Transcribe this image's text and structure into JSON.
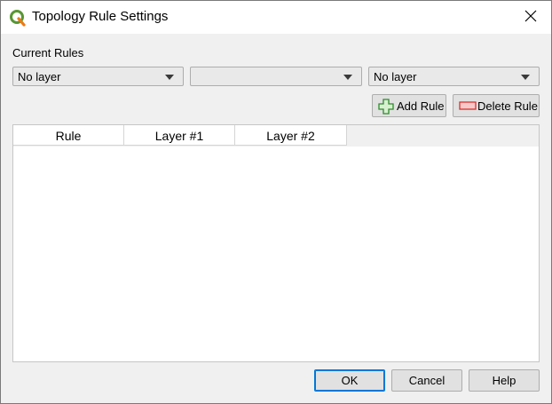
{
  "window": {
    "title": "Topology Rule Settings",
    "app_icon": "qgis-icon",
    "close_icon": "close-icon"
  },
  "current_rules": {
    "label": "Current Rules",
    "layer1_combo": {
      "value": "No layer"
    },
    "rule_combo": {
      "value": ""
    },
    "layer2_combo": {
      "value": "No layer"
    }
  },
  "actions": {
    "add_rule": {
      "label": "Add Rule",
      "icon": "plus-icon",
      "color": "#2e8b2e"
    },
    "delete_rule": {
      "label": "Delete Rule",
      "icon": "minus-icon",
      "color": "#d9302c"
    }
  },
  "rules_table": {
    "columns": [
      "Rule",
      "Layer #1",
      "Layer #2"
    ],
    "rows": []
  },
  "footer": {
    "ok": "OK",
    "cancel": "Cancel",
    "help": "Help"
  },
  "colors": {
    "accent": "#0078d7",
    "qgis_green": "#589632",
    "qgis_yellow": "#ee7913"
  }
}
